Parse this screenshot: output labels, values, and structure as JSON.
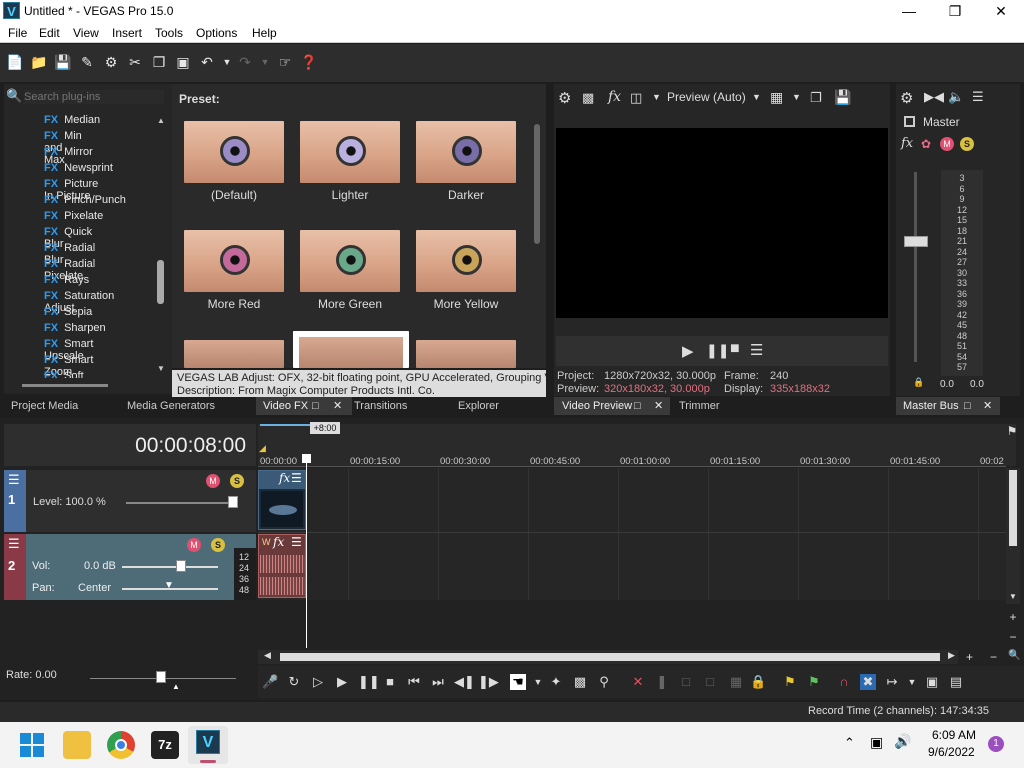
{
  "window": {
    "title": "Untitled * - VEGAS Pro 15.0",
    "app_icon_letter": "V"
  },
  "menu": [
    "File",
    "Edit",
    "View",
    "Insert",
    "Tools",
    "Options",
    "Help"
  ],
  "plugins": {
    "search_placeholder": "Search plug-ins",
    "items": [
      "Median",
      "Min and Max",
      "Mirror",
      "Newsprint",
      "Picture In Picture",
      "Pinch/Punch",
      "Pixelate",
      "Quick Blur",
      "Radial Blur",
      "Radial Pixelate",
      "Rays",
      "Saturation Adjust",
      "Sepia",
      "Sharpen",
      "Smart Upscale",
      "Smart Zoom",
      "Soft Contrast"
    ],
    "fx_tag": "FX"
  },
  "presets": {
    "label": "Preset:",
    "items": [
      {
        "name": "(Default)",
        "tint": "#9b8cc8"
      },
      {
        "name": "Lighter",
        "tint": "#b9b0e0"
      },
      {
        "name": "Darker",
        "tint": "#7a6ea8"
      },
      {
        "name": "More Red",
        "tint": "#c46a9a"
      },
      {
        "name": "More Green",
        "tint": "#6aa88a"
      },
      {
        "name": "More Yellow",
        "tint": "#c8a45a"
      }
    ],
    "description_line1": "VEGAS LAB Adjust: OFX, 32-bit floating point, GPU Accelerated, Grouping VE",
    "description_line2": "Description: From Magix Computer Products Intl. Co."
  },
  "left_tabs": [
    "Project Media",
    "Media Generators",
    "Video FX",
    "Transitions",
    "Explorer"
  ],
  "preview": {
    "mode": "Preview (Auto)",
    "project_label": "Project:",
    "project_value": "1280x720x32, 30.000p",
    "preview_label": "Preview:",
    "preview_value": "320x180x32, 30.000p",
    "frame_label": "Frame:",
    "frame_value": "240",
    "display_label": "Display:",
    "display_value": "335x188x32",
    "tabs": [
      "Video Preview",
      "Trimmer"
    ]
  },
  "master": {
    "label": "Master",
    "tab": "Master Bus",
    "meter_ticks": [
      "3",
      "6",
      "9",
      "12",
      "15",
      "18",
      "21",
      "24",
      "27",
      "30",
      "33",
      "36",
      "39",
      "42",
      "45",
      "48",
      "51",
      "54",
      "57"
    ],
    "left_val": "0.0",
    "right_val": "0.0"
  },
  "timeline": {
    "time": "00:00:08:00",
    "marker_badge": "+8:00",
    "ruler": [
      "00:00:00",
      "00:00:15:00",
      "00:00:30:00",
      "00:00:45:00",
      "00:01:00:00",
      "00:01:15:00",
      "00:01:30:00",
      "00:01:45:00",
      "00:02"
    ],
    "track1": {
      "number": "1",
      "level_label": "Level: 100.0 %"
    },
    "track2": {
      "number": "2",
      "vol_label": "Vol:",
      "vol_value": "0.0 dB",
      "pan_label": "Pan:",
      "pan_value": "Center",
      "db_ticks": [
        "12",
        "24",
        "36",
        "48"
      ]
    },
    "rate": "Rate: 0.00"
  },
  "status": {
    "record_time": "Record Time (2 channels): 147:34:35"
  },
  "taskbar": {
    "time": "6:09 AM",
    "date": "9/6/2022",
    "notif_count": "1",
    "sevenzip": "7z",
    "vegas": "V"
  }
}
